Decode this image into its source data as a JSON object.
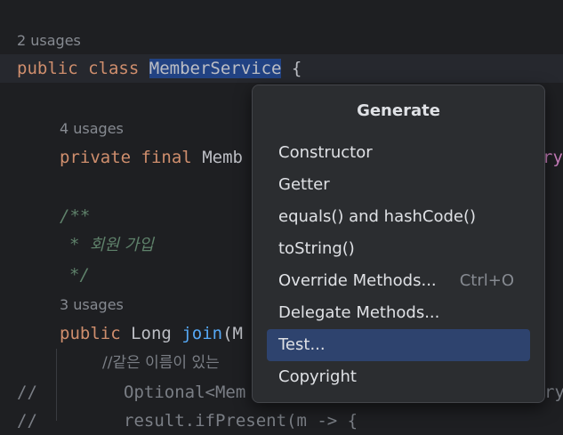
{
  "editor": {
    "usages_class": "2 usages",
    "kw_public": "public",
    "kw_class": "class",
    "class_name": "MemberService",
    "brace_open": "{",
    "usages_field": "4 usages",
    "kw_private": "private",
    "kw_final": "final",
    "field_type_partial": "Memb",
    "field_tail": "ry",
    "doc_open": "/**",
    "doc_star": "*",
    "doc_text": "회원 가입",
    "doc_close": "*/",
    "usages_join": "3 usages",
    "kw_public2": "public",
    "ret_type": "Long",
    "method_name": "join",
    "method_args_partial": "(M",
    "comment_korean": "//같은 이름이 있는",
    "comment_marker_1": "//",
    "optional_text": "Optional<Mem",
    "optional_tail": "ry",
    "comment_marker_2": "//",
    "result_text": "result.ifPresent(m -> {"
  },
  "popup": {
    "title": "Generate",
    "items": [
      {
        "label": "Constructor",
        "shortcut": ""
      },
      {
        "label": "Getter",
        "shortcut": ""
      },
      {
        "label": "equals() and hashCode()",
        "shortcut": ""
      },
      {
        "label": "toString()",
        "shortcut": ""
      },
      {
        "label": "Override Methods...",
        "shortcut": "Ctrl+O"
      },
      {
        "label": "Delegate Methods...",
        "shortcut": ""
      },
      {
        "label": "Test...",
        "shortcut": ""
      },
      {
        "label": "Copyright",
        "shortcut": ""
      }
    ],
    "selected_index": 6
  },
  "colors": {
    "background": "#1e1f22",
    "keyword": "#cf8e6d",
    "method": "#56a8f5",
    "doc_comment": "#5f826b",
    "selection": "#214283",
    "popup_bg": "#2b2d30",
    "popup_selected": "#2e436e"
  }
}
